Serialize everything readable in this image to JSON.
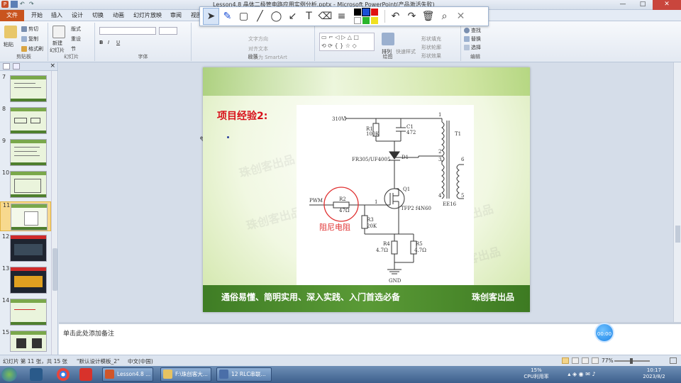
{
  "window": {
    "title": "Lesson4.8 晶体二极管电路应用实例分析.pptx - Microsoft PowerPoint(产品激活失败)",
    "controls": [
      "—",
      "□",
      "✕"
    ]
  },
  "ribbon_tabs": [
    "文件",
    "开始",
    "插入",
    "设计",
    "切换",
    "动画",
    "幻灯片放映",
    "审阅",
    "视图"
  ],
  "clipboard": {
    "paste": "粘贴",
    "cut": "剪切",
    "copy": "复制",
    "format_painter": "格式刷",
    "label": "剪贴板"
  },
  "slides_group": {
    "new_slide": "新建",
    "new_slide2": "幻灯片",
    "layout": "版式",
    "reset": "重设",
    "section": "节",
    "label": "幻灯片"
  },
  "font_group": {
    "label": "字体"
  },
  "paragraph_group": {
    "text_direction": "文字方向",
    "align_text": "对齐文本",
    "smartart": "转换为 SmartArt",
    "label": "段落"
  },
  "drawing_group": {
    "arrange": "排列",
    "quick_styles": "快速样式",
    "shape_fill": "形状填充",
    "shape_outline": "形状轮廓",
    "shape_effects": "形状效果",
    "label": "绘图"
  },
  "editing_group": {
    "find": "查找",
    "replace": "替换",
    "select": "选择",
    "label": "编辑"
  },
  "draw_toolbar": {
    "tools": [
      "pointer",
      "pen",
      "rectangle",
      "line",
      "ellipse",
      "arrow",
      "text",
      "eraser",
      "line-width"
    ],
    "colors": [
      "#000000",
      "#1a4fd6",
      "#e01010",
      "#ffffff",
      "#2ab52a",
      "#f0e020"
    ],
    "selected_color": "#1a4fd6",
    "actions": [
      "undo",
      "redo",
      "delete",
      "zoom",
      "close"
    ]
  },
  "slides_pane": {
    "numbers": [
      "7",
      "8",
      "9",
      "10",
      "11",
      "12",
      "13",
      "14",
      "15"
    ],
    "selected": "11"
  },
  "slide": {
    "title": "项目经验2:",
    "slogan": "通俗易懂、简明实用、深入实践、入门首选必备",
    "brand": "珠创客出品",
    "watermark": "珠创客出品",
    "circuit": {
      "vin": "310V",
      "r1": "R1",
      "r1_val": "100K",
      "c1": "C1",
      "c1_val": "472",
      "d1": "D1",
      "d1_part": "FR305/UF4005",
      "t1": "T1",
      "transformer": "EE16",
      "pins": [
        "1",
        "2",
        "3",
        "4",
        "5",
        "6"
      ],
      "pwm": "PWM",
      "r2": "R2",
      "r2_val": "47Ω",
      "damping": "阻尼电阻",
      "q1": "Q1",
      "q1_part": "TFP2  f4N60",
      "gate_pin": "1",
      "r3": "R3",
      "r3_val": "20K",
      "r4": "R4",
      "r4_val": "4.7Ω",
      "r5": "R5",
      "r5_val": "4.7Ω",
      "gnd": "GND"
    }
  },
  "notes": {
    "placeholder": "单击此处添加备注"
  },
  "timer": "00:00",
  "statusbar": {
    "slide_info": "幻灯片 第 11 张，共 15 张",
    "theme": "\"默认设计模板_2\"",
    "language": "中文(中国)",
    "zoom": "77%"
  },
  "taskbar": {
    "apps": [
      "Lesson4.8 ...",
      "F:\\珠创客大...",
      "12 RLC串联..."
    ],
    "cpu": "15%",
    "cpu_label": "CPU利用率",
    "time": "10:17",
    "date": "2023/8/2"
  }
}
